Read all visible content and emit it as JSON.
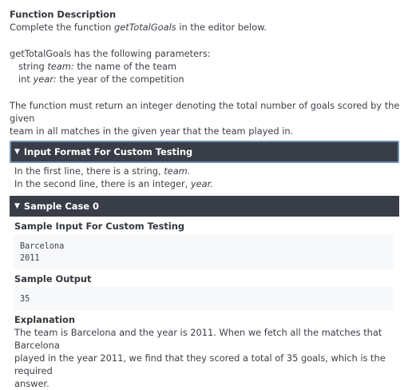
{
  "fd": {
    "title": "Function Description",
    "line1_pre": "Complete the function ",
    "line1_fn": "getTotalGoals",
    "line1_post": " in the editor below.",
    "params_intro": "getTotalGoals has the following parameters:",
    "param1_type": "string ",
    "param1_name": "team:",
    "param1_desc": " the name of the team",
    "param2_type": "int ",
    "param2_name": "year:",
    "param2_desc": " the year of the competition",
    "return_line1": "The function must return an integer denoting the total number of goals scored by the given",
    "return_line2": "team in all matches in the given year that the team played in."
  },
  "input_format": {
    "header": "Input Format For Custom Testing",
    "line1_pre": "In the first line, there is a string, ",
    "line1_var": "team.",
    "line2_pre": "In the second line, there is an integer, ",
    "line2_var": "year."
  },
  "sample": {
    "header": "Sample Case 0",
    "input_label": "Sample Input For Custom Testing",
    "input_lines": [
      "Barcelona",
      "2011"
    ],
    "output_label": "Sample Output",
    "output_value": "35",
    "explanation_label": "Explanation",
    "explanation_lines": [
      "The team is Barcelona and the year is 2011. When we fetch all the matches that Barcelona",
      "played in the year 2011, we find that they scored a total of 35 goals, which is the required",
      "answer."
    ]
  },
  "icons": {
    "expanded": "triangle-down-icon"
  }
}
